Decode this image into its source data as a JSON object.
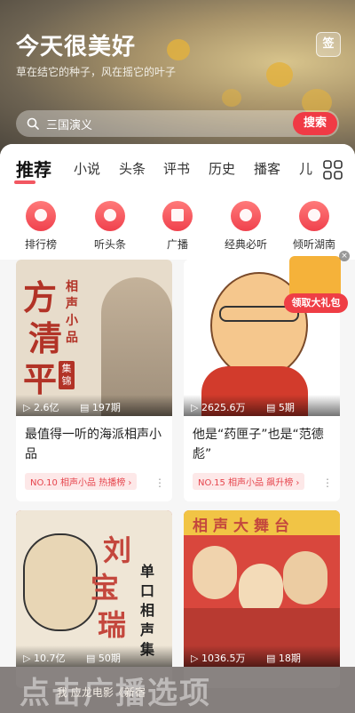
{
  "header": {
    "title": "今天很美好",
    "subtitle": "草在结它的种子，风在摇它的叶子",
    "sign_label": "签"
  },
  "search": {
    "placeholder": "三国演义",
    "button_label": "搜索"
  },
  "tabs": [
    "推荐",
    "小说",
    "头条",
    "评书",
    "历史",
    "播客",
    "儿"
  ],
  "quick_links": [
    {
      "label": "排行榜",
      "icon": "trophy-icon"
    },
    {
      "label": "听头条",
      "icon": "headline-icon"
    },
    {
      "label": "广播",
      "icon": "radio-icon"
    },
    {
      "label": "经典必听",
      "icon": "flame-icon"
    },
    {
      "label": "倾听湖南",
      "icon": "location-icon"
    }
  ],
  "cards": [
    {
      "cover_text": [
        "方",
        "清",
        "平"
      ],
      "cover_side": "相声小品",
      "cover_badge": "集锦",
      "plays": "2.6亿",
      "episodes": "197期",
      "title": "最值得一听的海派相声小品",
      "tag": "NO.10 相声小品 热播榜 ›"
    },
    {
      "plays": "2625.6万",
      "episodes": "5期",
      "title": "他是“药匣子”也是“范德彪”",
      "tag": "NO.15 相声小品 飙升榜 ›"
    },
    {
      "cover_text": [
        "刘",
        "宝",
        "瑞"
      ],
      "cover_side": "单口相声集",
      "plays": "10.7亿",
      "episodes": "50期"
    },
    {
      "cover_title": "相声大舞台",
      "plays": "1036.5万",
      "episodes": "18期"
    }
  ],
  "promo": {
    "label": "领取大礼包",
    "close": "×"
  },
  "banner": {
    "big_text": "点击广播选项",
    "small_text": "我    应龙电影《新宿"
  },
  "colors": {
    "accent": "#f03a45",
    "tag_bg": "#fde8e8"
  }
}
